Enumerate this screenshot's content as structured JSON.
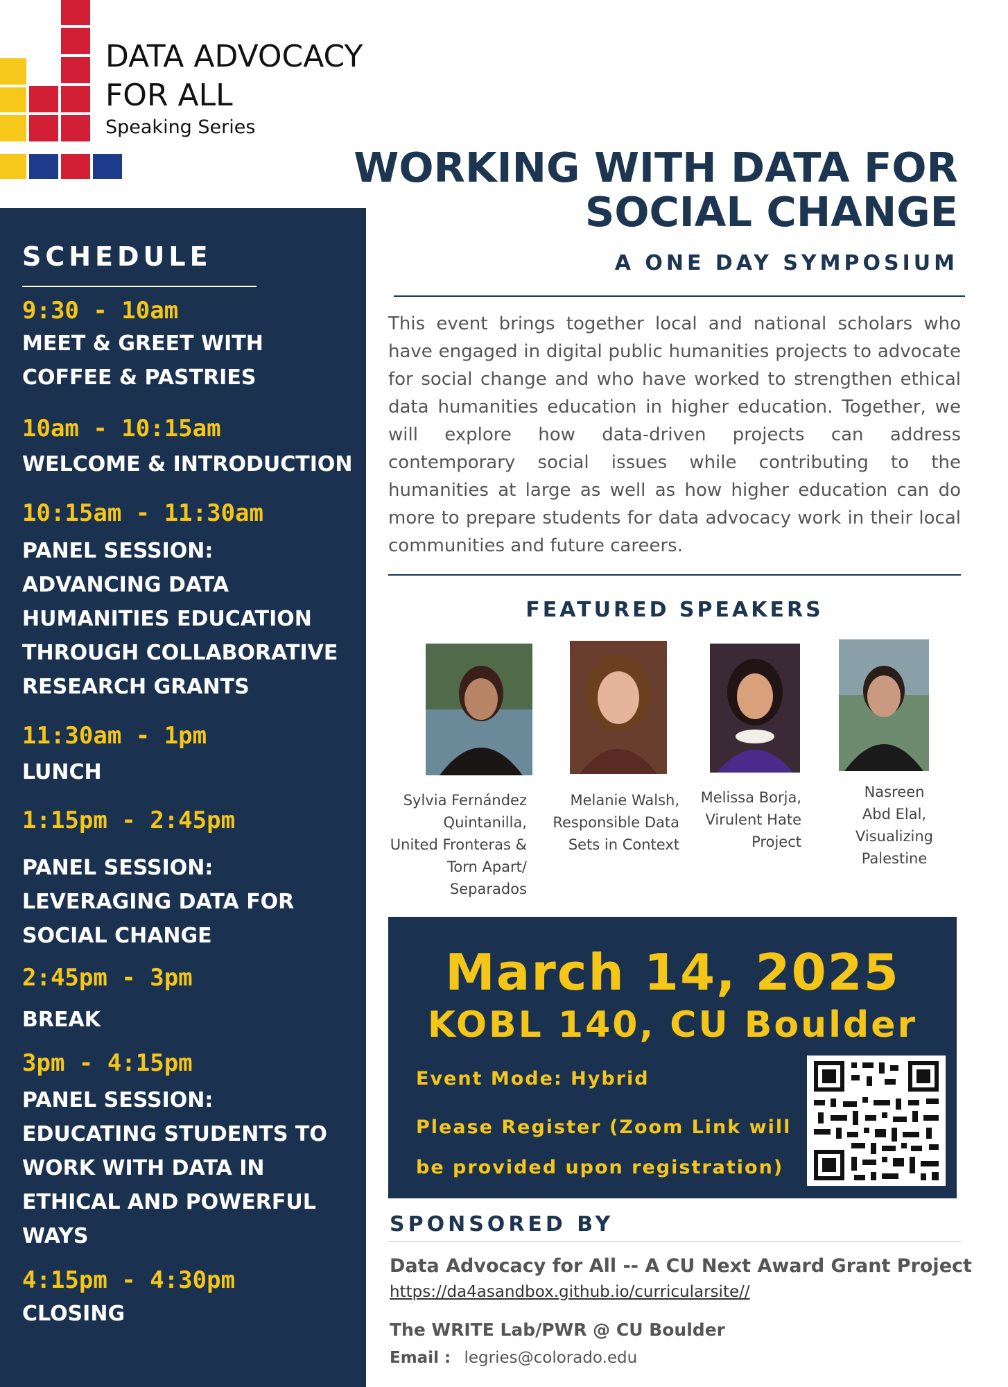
{
  "logo": {
    "line1": "DATA ADVOCACY",
    "line2": "FOR ALL",
    "line3": "Speaking Series"
  },
  "title": {
    "line1": "WORKING WITH DATA FOR",
    "line2": "SOCIAL CHANGE",
    "subtitle": "A ONE DAY SYMPOSIUM"
  },
  "description": "This event brings together local and national scholars who have engaged in digital public humanities projects to advocate for social change and who have worked to strengthen ethical data humanities education in higher education. Together, we will explore how data-driven projects can address contemporary social issues while contributing to the humanities at large as well as how higher education can do more to prepare students for data advocacy work in their local communities and future careers.",
  "speakers": {
    "heading": "FEATURED SPEAKERS",
    "items": [
      {
        "lines": [
          "Sylvia Fernández",
          "Quintanilla,",
          "United Fronteras &",
          "Torn Apart/",
          "Separados"
        ]
      },
      {
        "lines": [
          "Melanie Walsh,",
          "Responsible Data",
          "Sets in Context"
        ]
      },
      {
        "lines": [
          "Melissa Borja,",
          "Virulent Hate",
          "Project"
        ]
      },
      {
        "lines": [
          "Nasreen",
          "Abd Elal,",
          "Visualizing",
          "Palestine"
        ]
      }
    ]
  },
  "schedule": {
    "heading": "SCHEDULE",
    "items": [
      {
        "time": "9:30 - 10am",
        "lines": [
          "MEET & GREET WITH",
          "COFFEE & PASTRIES"
        ]
      },
      {
        "time": "10am - 10:15am",
        "lines": [
          "WELCOME & INTRODUCTION"
        ]
      },
      {
        "time": "10:15am - 11:30am",
        "lines": [
          "PANEL SESSION:",
          "ADVANCING DATA",
          "HUMANITIES EDUCATION",
          "THROUGH COLLABORATIVE",
          "RESEARCH GRANTS"
        ]
      },
      {
        "time": "11:30am - 1pm",
        "lines": [
          "LUNCH"
        ]
      },
      {
        "time": "1:15pm - 2:45pm",
        "lines": [
          "PANEL SESSION:",
          "LEVERAGING DATA FOR",
          "SOCIAL CHANGE"
        ]
      },
      {
        "time": "2:45pm - 3pm",
        "lines": [
          "BREAK"
        ]
      },
      {
        "time": "3pm - 4:15pm",
        "lines": [
          "PANEL SESSION:",
          "EDUCATING STUDENTS TO",
          "WORK WITH DATA IN",
          "ETHICAL AND POWERFUL",
          "WAYS"
        ]
      },
      {
        "time": "4:15pm - 4:30pm",
        "lines": [
          "CLOSING"
        ]
      }
    ]
  },
  "event": {
    "date": "March 14, 2025",
    "venue": "KOBL 140, CU Boulder",
    "mode": "Event Mode: Hybrid",
    "register1": "Please Register (Zoom Link will",
    "register2": "be provided upon registration)"
  },
  "sponsors": {
    "heading": "SPONSORED BY",
    "org1": "Data Advocacy for All -- A CU Next Award Grant Project",
    "link": "https://da4asandbox.github.io/curricularsite//",
    "org2": "The WRITE Lab/PWR @ CU Boulder",
    "email_label": "Email :",
    "email": "legries@colorado.edu"
  },
  "colors": {
    "navy": "#1a3250",
    "gold": "#f5c518",
    "red": "#d21f35",
    "yellow": "#f6c81a",
    "blue": "#1e3a8a"
  }
}
